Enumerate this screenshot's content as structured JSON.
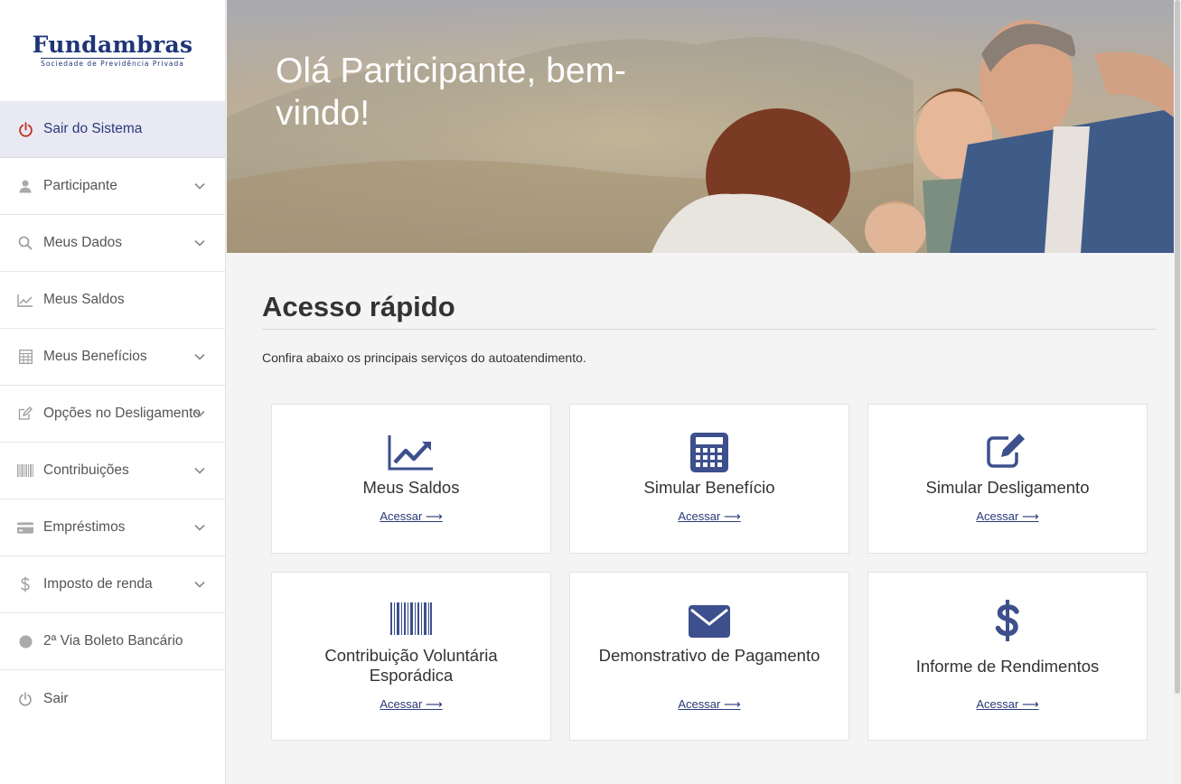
{
  "brand": {
    "name": "Fundambras",
    "tagline": "Sociedade de Previdência Privada",
    "color": "#1f3578"
  },
  "sidebar": {
    "items": [
      {
        "label": "Sair do Sistema",
        "icon": "power-icon"
      },
      {
        "label": "Participante",
        "icon": "user-icon"
      },
      {
        "label": "Meus Dados",
        "icon": "search-icon"
      },
      {
        "label": "Meus Saldos",
        "icon": "line-chart-icon"
      },
      {
        "label": "Meus Benefícios",
        "icon": "calculator-icon"
      },
      {
        "label": "Opções no Desligamento",
        "icon": "edit-icon"
      },
      {
        "label": "Contribuições",
        "icon": "barcode-icon"
      },
      {
        "label": "Empréstimos",
        "icon": "credit-card-icon"
      },
      {
        "label": "Imposto de renda",
        "icon": "dollar-icon"
      },
      {
        "label": "2ª Via Boleto Bancário",
        "icon": "circle-icon"
      },
      {
        "label": "Sair",
        "icon": "power-icon"
      }
    ]
  },
  "hero": {
    "title": "Olá Participante, bem-vindo!"
  },
  "quick_access": {
    "title": "Acesso rápido",
    "subtitle": "Confira abaixo os principais serviços do autoatendimento.",
    "cards": [
      {
        "title": "Meus Saldos",
        "link": "Acessar ⟶",
        "icon": "line-chart-icon"
      },
      {
        "title": "Simular Benefício",
        "link": "Acessar ⟶",
        "icon": "calculator-icon"
      },
      {
        "title": "Simular Desligamento",
        "link": "Acessar ⟶",
        "icon": "edit-icon"
      },
      {
        "title": "Contribuição Voluntária Esporádica",
        "link": "Acessar ⟶",
        "icon": "barcode-icon"
      },
      {
        "title": "Demonstrativo de Pagamento",
        "link": "Acessar ⟶",
        "icon": "envelope-icon"
      },
      {
        "title": "Informe de Rendimentos",
        "link": "Acessar ⟶",
        "icon": "dollar-icon"
      }
    ]
  },
  "colors": {
    "accent": "#3d4f8c",
    "active_bg": "#e9e9f4",
    "logout_red": "#c0392b"
  }
}
